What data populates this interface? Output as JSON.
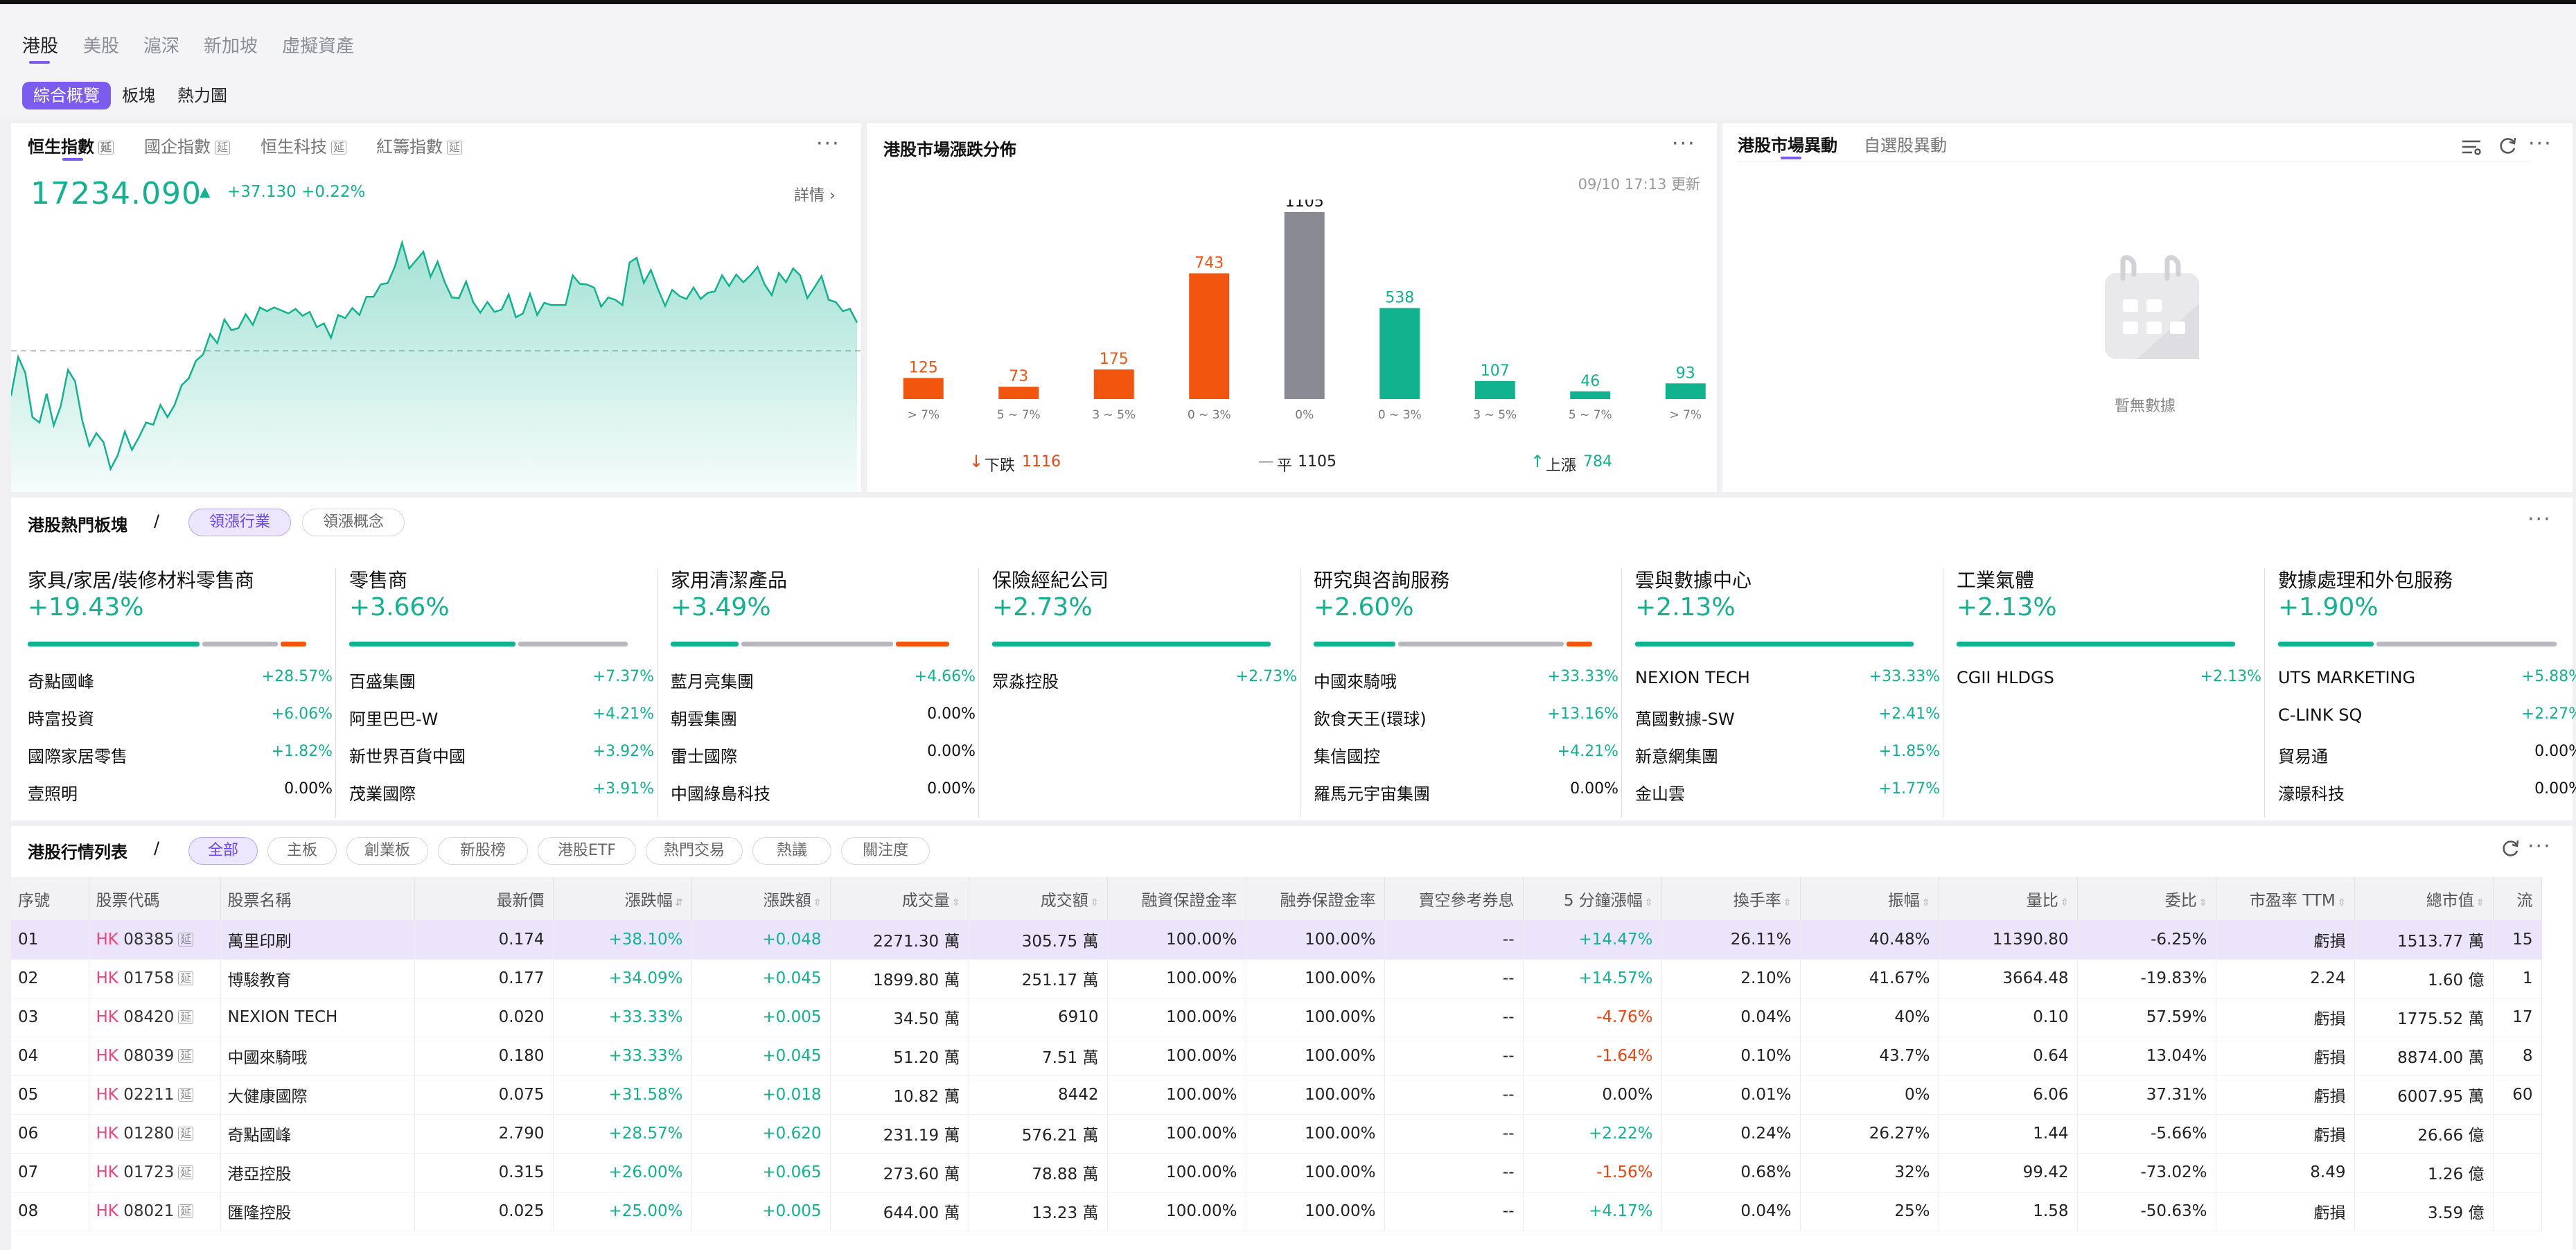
{
  "market_tabs": [
    "港股",
    "美股",
    "滬深",
    "新加坡",
    "虛擬資產"
  ],
  "sub_tabs": [
    "綜合概覽",
    "板塊",
    "熱力圖"
  ],
  "index_panel": {
    "tabs": [
      "恒生指數",
      "國企指數",
      "恒生科技",
      "紅籌指數"
    ],
    "delay_badge": "延",
    "value": "17234.090",
    "arrow": "▲",
    "change": "+37.130 +0.22%",
    "detail_label": "詳情 ›"
  },
  "distribution": {
    "title": "港股市場漲跌分佈",
    "updated": "09/10 17:13 更新",
    "down_label": "下跌",
    "down_count": "1116",
    "flat_label": "平",
    "flat_count": "1105",
    "up_label": "上漲",
    "up_count": "784"
  },
  "chart_data": [
    {
      "type": "area",
      "title": "恒生指數",
      "x": [
        0,
        1,
        2,
        3,
        4,
        5,
        6,
        7,
        8,
        9,
        10,
        11,
        12,
        13,
        14,
        15,
        16,
        17,
        18,
        19,
        20,
        21,
        22,
        23,
        24,
        25,
        26,
        27,
        28,
        29,
        30,
        31,
        32,
        33,
        34,
        35,
        36,
        37,
        38,
        39,
        40,
        41,
        42,
        43,
        44,
        45,
        46,
        47,
        48,
        49,
        50,
        51,
        52,
        53,
        54,
        55,
        56,
        57,
        58,
        59,
        60,
        61,
        62,
        63,
        64,
        65,
        66,
        67,
        68,
        69,
        70,
        71,
        72,
        73,
        74,
        75,
        76,
        77,
        78,
        79,
        80,
        81,
        82,
        83,
        84,
        85,
        86,
        87,
        88,
        89,
        90,
        91,
        92,
        93,
        94,
        95,
        96,
        97,
        98,
        99,
        100,
        101,
        102,
        103,
        104,
        105,
        106,
        107,
        108,
        109,
        110,
        111,
        112,
        113,
        114,
        115,
        116,
        117,
        118,
        119
      ],
      "y": [
        17138,
        17189,
        17168,
        17110,
        17103,
        17141,
        17099,
        17125,
        17172,
        17157,
        17106,
        17072,
        17089,
        17077,
        17042,
        17060,
        17091,
        17067,
        17084,
        17103,
        17100,
        17126,
        17110,
        17126,
        17152,
        17161,
        17184,
        17192,
        17219,
        17207,
        17238,
        17224,
        17227,
        17245,
        17231,
        17254,
        17249,
        17254,
        17250,
        17246,
        17252,
        17243,
        17248,
        17228,
        17233,
        17214,
        17244,
        17240,
        17253,
        17244,
        17268,
        17268,
        17284,
        17286,
        17308,
        17339,
        17305,
        17316,
        17327,
        17294,
        17314,
        17287,
        17267,
        17266,
        17288,
        17261,
        17247,
        17261,
        17248,
        17251,
        17271,
        17241,
        17246,
        17272,
        17244,
        17260,
        17257,
        17257,
        17257,
        17296,
        17285,
        17284,
        17280,
        17255,
        17267,
        17264,
        17257,
        17313,
        17319,
        17286,
        17303,
        17278,
        17256,
        17277,
        17269,
        17265,
        17280,
        17265,
        17273,
        17275,
        17296,
        17282,
        17297,
        17287,
        17296,
        17307,
        17284,
        17270,
        17299,
        17287,
        17305,
        17296,
        17266,
        17280,
        17295,
        17264,
        17261,
        17249,
        17252,
        17234
      ],
      "prev_close": 17197
    },
    {
      "type": "bar",
      "title": "港股市場漲跌分佈",
      "categories": [
        "> 7%",
        "5 ~ 7%",
        "3 ~ 5%",
        "0 ~ 3%",
        "0%",
        "0 ~ 3%",
        "3 ~ 5%",
        "5 ~ 7%",
        "> 7%"
      ],
      "values": [
        125,
        73,
        175,
        743,
        1105,
        538,
        107,
        46,
        93
      ],
      "colors": [
        "#f2550e",
        "#f2550e",
        "#f2550e",
        "#f2550e",
        "#8a8a95",
        "#10b38e",
        "#10b38e",
        "#10b38e",
        "#10b38e"
      ]
    }
  ],
  "anomaly": {
    "tabs": [
      "港股市場異動",
      "自選股異動"
    ],
    "empty_text": "暫無數據"
  },
  "sectors_panel": {
    "title": "港股熱門板塊",
    "separator": "/",
    "tabs": [
      "領漲行業",
      "領漲概念"
    ],
    "sectors": [
      {
        "name": "家具/家居/裝修材料零售商",
        "pct": "+19.43%",
        "bar": [
          0.62,
          0.28,
          0.1
        ],
        "rows": [
          [
            "奇點國峰",
            "+28.57%"
          ],
          [
            "時富投資",
            "+6.06%"
          ],
          [
            "國際家居零售",
            "+1.82%"
          ],
          [
            "壹照明",
            "0.00%"
          ]
        ]
      },
      {
        "name": "零售商",
        "pct": "+3.66%",
        "bar": [
          0.6,
          0.4,
          0
        ],
        "rows": [
          [
            "百盛集團",
            "+7.37%"
          ],
          [
            "阿里巴巴-W",
            "+4.21%"
          ],
          [
            "新世界百貨中國",
            "+3.92%"
          ],
          [
            "茂業國際",
            "+3.91%"
          ]
        ]
      },
      {
        "name": "家用清潔產品",
        "pct": "+3.49%",
        "bar": [
          0.25,
          0.55,
          0.2
        ],
        "rows": [
          [
            "藍月亮集團",
            "+4.66%"
          ],
          [
            "朝雲集團",
            "0.00%"
          ],
          [
            "雷士國際",
            "0.00%"
          ],
          [
            "中國綠島科技",
            "0.00%"
          ]
        ]
      },
      {
        "name": "保險經紀公司",
        "pct": "+2.73%",
        "bar": [
          1,
          0,
          0
        ],
        "rows": [
          [
            "眾淼控股",
            "+2.73%"
          ]
        ]
      },
      {
        "name": "研究與咨詢服務",
        "pct": "+2.60%",
        "bar": [
          0.3,
          0.6,
          0.1
        ],
        "rows": [
          [
            "中國來騎哦",
            "+33.33%"
          ],
          [
            "飲食天王(環球)",
            "+13.16%"
          ],
          [
            "集信國控",
            "+4.21%"
          ],
          [
            "羅馬元宇宙集團",
            "0.00%"
          ]
        ]
      },
      {
        "name": "雲與數據中心",
        "pct": "+2.13%",
        "bar": [
          1,
          0,
          0
        ],
        "rows": [
          [
            "NEXION TECH",
            "+33.33%"
          ],
          [
            "萬國數據-SW",
            "+2.41%"
          ],
          [
            "新意網集團",
            "+1.85%"
          ],
          [
            "金山雲",
            "+1.77%"
          ]
        ]
      },
      {
        "name": "工業氣體",
        "pct": "+2.13%",
        "bar": [
          1,
          0,
          0
        ],
        "rows": [
          [
            "CGII HLDGS",
            "+2.13%"
          ]
        ]
      },
      {
        "name": "數據處理和外包服務",
        "pct": "+1.90%",
        "bar": [
          0.35,
          0.65,
          0
        ],
        "rows": [
          [
            "UTS MARKETING",
            "+5.88%"
          ],
          [
            "C-LINK SQ",
            "+2.27%"
          ],
          [
            "貿易通",
            "0.00%"
          ],
          [
            "濠暻科技",
            "0.00%"
          ]
        ]
      }
    ]
  },
  "quotes": {
    "title": "港股行情列表",
    "separator": "/",
    "filters": [
      "全部",
      "主板",
      "創業板",
      "新股榜",
      "港股ETF",
      "熱門交易",
      "熱議",
      "關注度"
    ],
    "columns": [
      "序號",
      "股票代碼",
      "股票名稱",
      "最新價",
      "漲跌幅",
      "漲跌額",
      "成交量",
      "成交額",
      "融資保證金率",
      "融券保證金率",
      "賣空參考券息",
      "5 分鐘漲幅",
      "換手率",
      "振幅",
      "量比",
      "委比",
      "市盈率 TTM",
      "總市值",
      "流"
    ],
    "market_prefix": "HK",
    "rows": [
      [
        "01",
        "08385",
        "萬里印刷",
        "0.174",
        "+38.10%",
        "+0.048",
        "2271.30 萬",
        "305.75 萬",
        "100.00%",
        "100.00%",
        "--",
        "+14.47%",
        "26.11%",
        "40.48%",
        "11390.80",
        "-6.25%",
        "虧損",
        "1513.77 萬",
        "15"
      ],
      [
        "02",
        "01758",
        "博駿教育",
        "0.177",
        "+34.09%",
        "+0.045",
        "1899.80 萬",
        "251.17 萬",
        "100.00%",
        "100.00%",
        "--",
        "+14.57%",
        "2.10%",
        "41.67%",
        "3664.48",
        "-19.83%",
        "2.24",
        "1.60 億",
        "1"
      ],
      [
        "03",
        "08420",
        "NEXION TECH",
        "0.020",
        "+33.33%",
        "+0.005",
        "34.50 萬",
        "6910",
        "100.00%",
        "100.00%",
        "--",
        "-4.76%",
        "0.04%",
        "40%",
        "0.10",
        "57.59%",
        "虧損",
        "1775.52 萬",
        "17"
      ],
      [
        "04",
        "08039",
        "中國來騎哦",
        "0.180",
        "+33.33%",
        "+0.045",
        "51.20 萬",
        "7.51 萬",
        "100.00%",
        "100.00%",
        "--",
        "-1.64%",
        "0.10%",
        "43.7%",
        "0.64",
        "13.04%",
        "虧損",
        "8874.00 萬",
        "8"
      ],
      [
        "05",
        "02211",
        "大健康國際",
        "0.075",
        "+31.58%",
        "+0.018",
        "10.82 萬",
        "8442",
        "100.00%",
        "100.00%",
        "--",
        "0.00%",
        "0.01%",
        "0%",
        "6.06",
        "37.31%",
        "虧損",
        "6007.95 萬",
        "60"
      ],
      [
        "06",
        "01280",
        "奇點國峰",
        "2.790",
        "+28.57%",
        "+0.620",
        "231.19 萬",
        "576.21 萬",
        "100.00%",
        "100.00%",
        "--",
        "+2.22%",
        "0.24%",
        "26.27%",
        "1.44",
        "-5.66%",
        "虧損",
        "26.66 億",
        ""
      ],
      [
        "07",
        "01723",
        "港亞控股",
        "0.315",
        "+26.00%",
        "+0.065",
        "273.60 萬",
        "78.88 萬",
        "100.00%",
        "100.00%",
        "--",
        "-1.56%",
        "0.68%",
        "32%",
        "99.42",
        "-73.02%",
        "8.49",
        "1.26 億",
        ""
      ],
      [
        "08",
        "08021",
        "匯隆控股",
        "0.025",
        "+25.00%",
        "+0.005",
        "644.00 萬",
        "13.23 萬",
        "100.00%",
        "100.00%",
        "--",
        "+4.17%",
        "0.04%",
        "25%",
        "1.58",
        "-50.63%",
        "虧損",
        "3.59 億",
        ""
      ]
    ]
  },
  "colors": {
    "accent": "#7b5bf0",
    "up": "#10b38e",
    "down": "#f2420e",
    "down_bar": "#f2550e",
    "flat_bar": "#8a8a95",
    "highlight_row": "#ece4fb"
  }
}
